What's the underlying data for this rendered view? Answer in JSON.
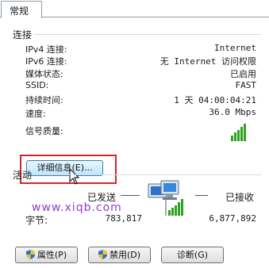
{
  "tabs": [
    {
      "label": "常规"
    }
  ],
  "connection": {
    "title": "连接",
    "rows": [
      {
        "label": "IPv4 连接:",
        "value": "Internet"
      },
      {
        "label": "IPv6 连接:",
        "value": "无 Internet 访问权限"
      },
      {
        "label": "媒体状态:",
        "value": "已启用"
      },
      {
        "label": "SSID:",
        "value": "FAST"
      },
      {
        "label": "持续时间:",
        "value": "1 天 04:00:04:21"
      },
      {
        "label": "速度:",
        "value": "36.0 Mbps"
      }
    ],
    "signal_label": "信号质量:",
    "signal_bars_active": 5,
    "signal_bars_total": 5,
    "detail_button": "详细信息(E)..."
  },
  "activity": {
    "title": "活动",
    "sent_label": "已发送",
    "received_label": "已接收",
    "bytes_label": "字节:",
    "bytes_sent": "783,817",
    "bytes_received": "6,877,892"
  },
  "watermark": "www.xiqb.com",
  "buttons": {
    "properties": "属性(P)",
    "disable": "禁用(D)",
    "diagnose": "诊断(G)"
  },
  "colors": {
    "highlight": "#d3262a",
    "signal": "#2fa31f",
    "watermark": "#8b3fd0"
  }
}
